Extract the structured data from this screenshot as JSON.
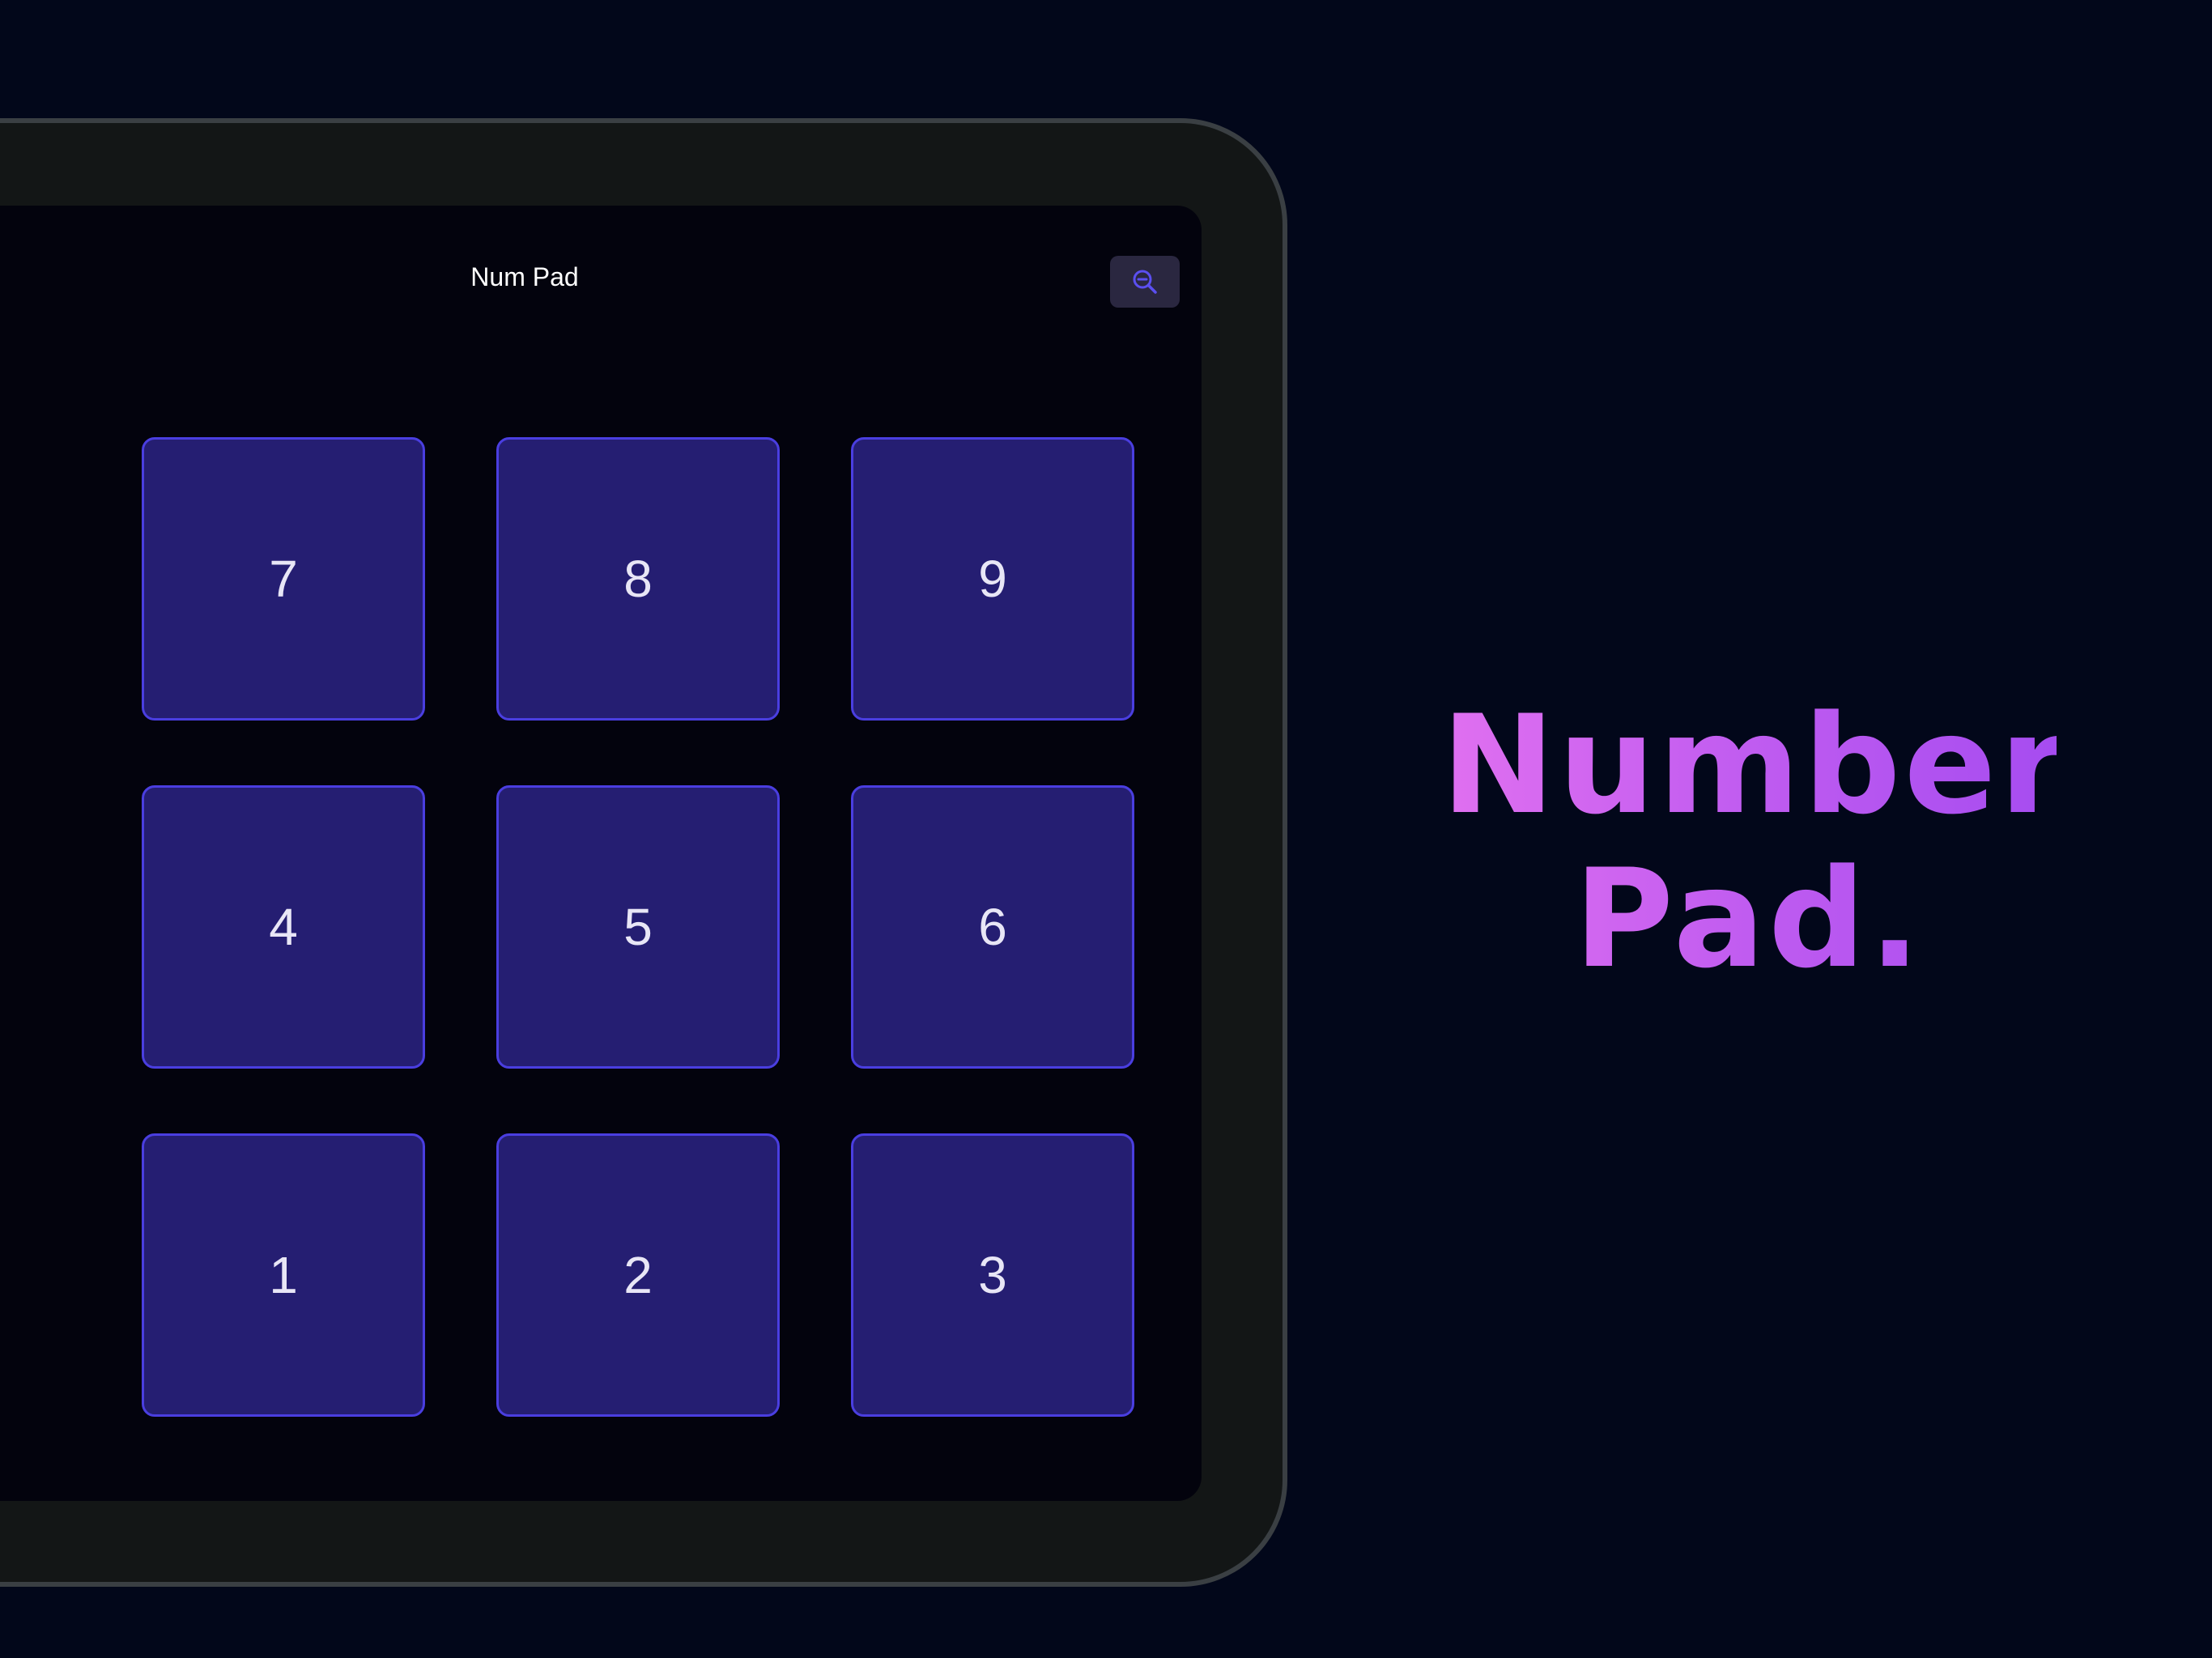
{
  "app": {
    "nav_title": "Num Pad",
    "zoom_icon": "zoom-out-icon"
  },
  "keypad": {
    "rows": [
      [
        "7",
        "8",
        "9"
      ],
      [
        "4",
        "5",
        "6"
      ],
      [
        "1",
        "2",
        "3"
      ]
    ]
  },
  "marketing": {
    "headline_line1": "Number",
    "headline_line2": "Pad."
  },
  "colors": {
    "background": "#02071a",
    "key_fill": "#251e72",
    "key_border": "#4a3ee0",
    "accent_gradient_start": "#e070f0",
    "accent_gradient_end": "#a64cf0"
  }
}
